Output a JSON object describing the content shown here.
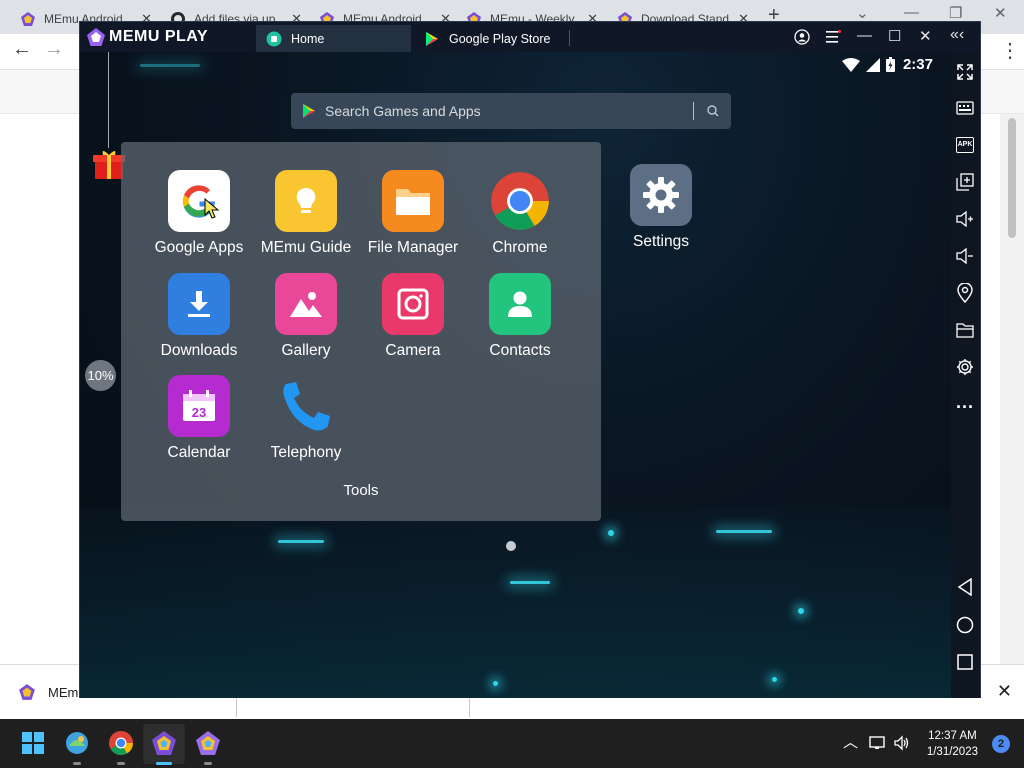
{
  "browser": {
    "tabs": [
      {
        "label": "MEmu Android",
        "icon": "memu-icon"
      },
      {
        "label": "Add files via up",
        "icon": "github-icon"
      },
      {
        "label": "MEmu Android",
        "icon": "memu-icon"
      },
      {
        "label": "MEmu - Weekly",
        "icon": "memu-icon"
      },
      {
        "label": "Download Stand",
        "icon": "memu-icon"
      }
    ],
    "new_tab": "+",
    "close_glyph": "✕"
  },
  "download_bar": {
    "item_label": "MEm",
    "close_glyph": "✕"
  },
  "memu": {
    "brand": "MEMU PLAY",
    "tabs": [
      {
        "label": "Home",
        "icon": "home-icon"
      },
      {
        "label": "Google Play Store",
        "icon": "play-store-icon"
      }
    ],
    "status_time": "2:37",
    "search_placeholder": "Search Games and Apps",
    "progress_label": "10%",
    "folder": {
      "title": "Tools",
      "apps": [
        {
          "label": "Google Apps",
          "icon": "google-apps-icon",
          "color": "#ffffff"
        },
        {
          "label": "MEmu Guide",
          "icon": "memu-guide-icon",
          "color": "#f9c531"
        },
        {
          "label": "File Manager",
          "icon": "file-manager-icon",
          "color": "#f58a1f"
        },
        {
          "label": "Chrome",
          "icon": "chrome-icon",
          "color": "#4285f4"
        },
        {
          "label": "Downloads",
          "icon": "downloads-icon",
          "color": "#2f7fe0"
        },
        {
          "label": "Gallery",
          "icon": "gallery-icon",
          "color": "#e94898"
        },
        {
          "label": "Camera",
          "icon": "camera-icon",
          "color": "#e8396a"
        },
        {
          "label": "Contacts",
          "icon": "contacts-icon",
          "color": "#22c47e"
        },
        {
          "label": "Calendar",
          "icon": "calendar-icon",
          "color": "#b52bd0"
        },
        {
          "label": "Telephony",
          "icon": "telephony-icon",
          "color": "#2196f3"
        }
      ]
    },
    "desktop_app": {
      "label": "Settings",
      "icon": "settings-icon",
      "color": "#5d6f84"
    },
    "sidebar_icons": [
      "expand-icon",
      "keyboard-icon",
      "apk-icon",
      "multi-window-icon",
      "volume-up-icon",
      "volume-down-icon",
      "location-icon",
      "folder-icon",
      "gear-icon",
      "more-icon",
      "back-icon",
      "home-button-icon",
      "recents-icon"
    ],
    "apk_text": "APK",
    "more_text": "..."
  },
  "taskbar": {
    "time": "12:37 AM",
    "date": "1/31/2023",
    "notifications": "2"
  }
}
